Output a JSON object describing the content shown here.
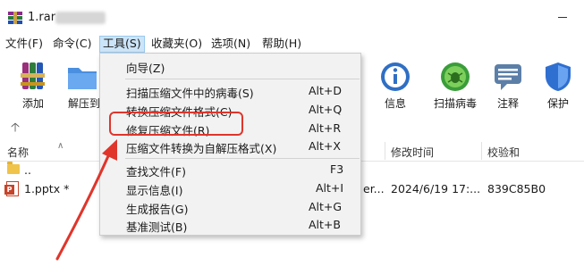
{
  "window": {
    "title": "1.rar"
  },
  "menubar": {
    "items": [
      {
        "label": "文件(F)"
      },
      {
        "label": "命令(C)"
      },
      {
        "label": "工具(S)"
      },
      {
        "label": "收藏夹(O)"
      },
      {
        "label": "选项(N)"
      },
      {
        "label": "帮助(H)"
      }
    ]
  },
  "toolbar": {
    "add": "添加",
    "extract": "解压到",
    "info": "信息",
    "scan": "扫描病毒",
    "comment": "注释",
    "protect": "保护"
  },
  "list": {
    "headers": {
      "name": "名称",
      "modified": "修改时间",
      "checksum": "校验和"
    },
    "rows": [
      {
        "name": "..",
        "type": "",
        "modified": "",
        "checksum": ""
      },
      {
        "name": "1.pptx *",
        "type": "er...",
        "modified": "2024/6/19 17:...",
        "checksum": "839C85B0"
      }
    ]
  },
  "tools_menu": {
    "items": [
      {
        "label": "向导(Z)",
        "shortcut": ""
      },
      {
        "label": "扫描压缩文件中的病毒(S)",
        "shortcut": "Alt+D"
      },
      {
        "label": "转换压缩文件格式(C)",
        "shortcut": "Alt+Q"
      },
      {
        "label": "修复压缩文件(R)",
        "shortcut": "Alt+R"
      },
      {
        "label": "压缩文件转换为自解压格式(X)",
        "shortcut": "Alt+X"
      },
      {
        "label": "查找文件(F)",
        "shortcut": "F3"
      },
      {
        "label": "显示信息(I)",
        "shortcut": "Alt+I"
      },
      {
        "label": "生成报告(G)",
        "shortcut": "Alt+G"
      },
      {
        "label": "基准测试(B)",
        "shortcut": "Alt+B"
      }
    ]
  },
  "colors": {
    "menu_active_bg": "#cce4f7",
    "highlight_red": "#e0352b",
    "dropdown_bg": "#f2f2f2"
  }
}
